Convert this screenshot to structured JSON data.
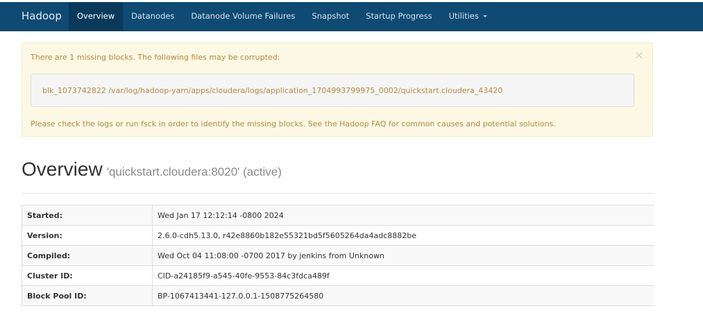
{
  "navbar": {
    "brand": "Hadoop",
    "items": [
      {
        "label": "Overview",
        "active": true
      },
      {
        "label": "Datanodes"
      },
      {
        "label": "Datanode Volume Failures"
      },
      {
        "label": "Snapshot"
      },
      {
        "label": "Startup Progress"
      },
      {
        "label": "Utilities",
        "dropdown": true
      }
    ],
    "background_color": "#0e4a72"
  },
  "alert": {
    "message": "There are 1 missing blocks. The following files may be corrupted:",
    "close_symbol": "×",
    "missing_block": "blk_1073742822 /var/log/hadoop-yarn/apps/cloudera/logs/application_1704993799975_0002/quickstart.cloudera_43420",
    "hint": "Please check the logs or run fsck in order to identify the missing blocks. See the Hadoop FAQ for common causes and potential solutions.",
    "color": "#b08a44"
  },
  "overview": {
    "title": "Overview",
    "subtitle": "'quickstart.cloudera:8020' (active)"
  },
  "info": [
    {
      "label": "Started:",
      "value": "Wed Jan 17 12:12:14 -0800 2024"
    },
    {
      "label": "Version:",
      "value": "2.6.0-cdh5.13.0, r42e8860b182e55321bd5f5605264da4adc8882be"
    },
    {
      "label": "Compiled:",
      "value": "Wed Oct 04 11:08:00 -0700 2017 by jenkins from Unknown"
    },
    {
      "label": "Cluster ID:",
      "value": "CID-a24185f9-a545-40fe-9553-84c3fdca489f"
    },
    {
      "label": "Block Pool ID:",
      "value": "BP-1067413441-127.0.0.1-1508775264580"
    }
  ]
}
